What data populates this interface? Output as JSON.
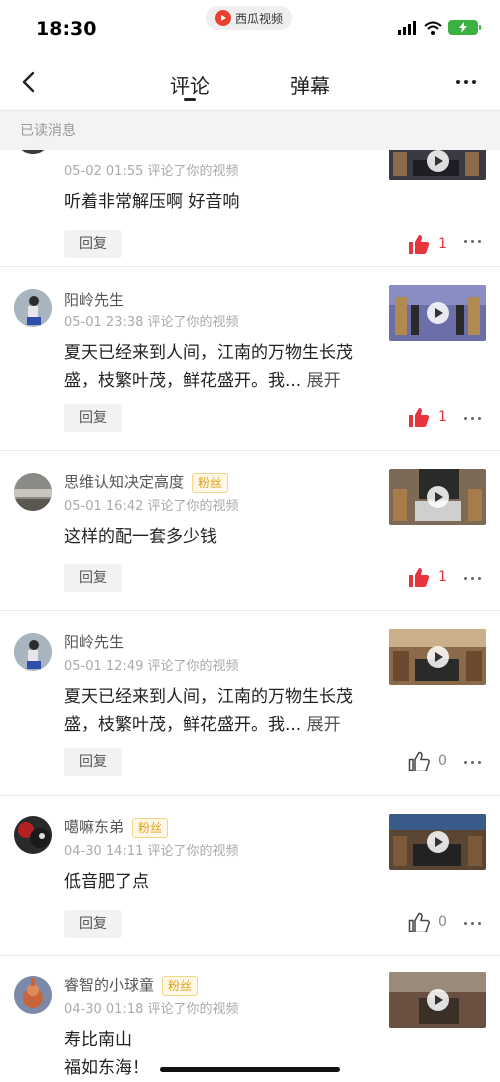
{
  "status": {
    "time": "18:30",
    "app": "西瓜视频"
  },
  "nav": {
    "tabs": [
      "评论",
      "弹幕"
    ]
  },
  "section": {
    "read_header": "已读消息"
  },
  "reply_label": "回复",
  "expand_label": "展开",
  "fan_label": "粉丝",
  "comments": [
    {
      "user": "",
      "meta": "05-02 01:55 评论了你的视频",
      "content": "听着非常解压啊 好音响",
      "likes": "1",
      "liked": true
    },
    {
      "user": "阳岭先生",
      "meta": "05-01 23:38 评论了你的视频",
      "content": "夏天已经来到人间，江南的万物生长茂盛，枝繁叶茂，鲜花盛开。我...",
      "likes": "1",
      "liked": true
    },
    {
      "user": "思维认知决定高度",
      "fan": true,
      "meta": "05-01 16:42 评论了你的视频",
      "content": "这样的配一套多少钱",
      "likes": "1",
      "liked": true
    },
    {
      "user": "阳岭先生",
      "meta": "05-01 12:49 评论了你的视频",
      "content": "夏天已经来到人间，江南的万物生长茂盛，枝繁叶茂，鲜花盛开。我...",
      "likes": "0",
      "liked": false
    },
    {
      "user": "噶嘛东弟",
      "fan": true,
      "meta": "04-30 14:11 评论了你的视频",
      "content": "低音肥了点",
      "likes": "0",
      "liked": false
    },
    {
      "user": "睿智的小球童",
      "fan": true,
      "meta": "04-30 01:18 评论了你的视频",
      "content_line1": "寿比南山",
      "content_line2": "福如东海！"
    }
  ]
}
